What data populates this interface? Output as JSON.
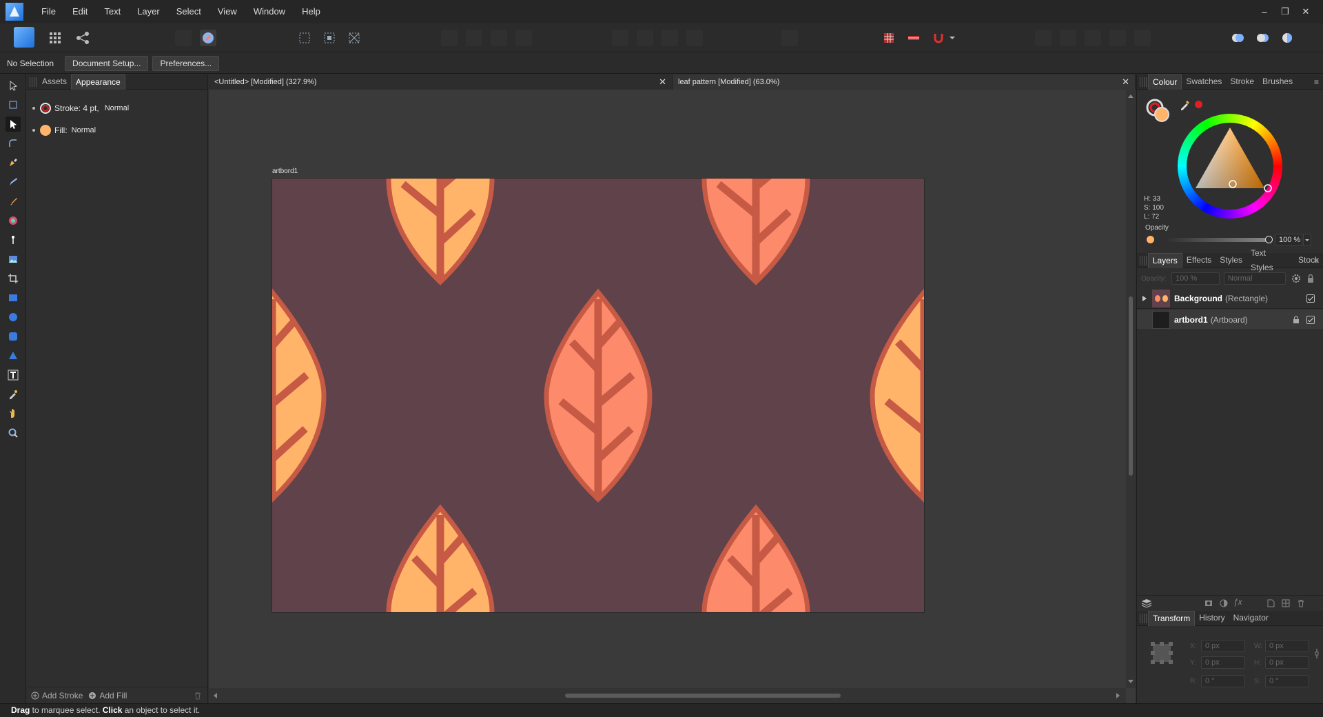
{
  "menu": {
    "items": [
      "File",
      "Edit",
      "Text",
      "Layer",
      "Select",
      "View",
      "Window",
      "Help"
    ]
  },
  "window_controls": {
    "minimize": "–",
    "restore": "❐",
    "close": "✕"
  },
  "context": {
    "selection": "No Selection",
    "doc_setup": "Document Setup...",
    "preferences": "Preferences..."
  },
  "left_panel": {
    "tabs": [
      "Assets",
      "Appearance"
    ],
    "stroke_label": "Stroke: 4 pt,",
    "stroke_mode": "Normal",
    "fill_label": "Fill:",
    "fill_mode": "Normal",
    "add_stroke": "Add Stroke",
    "add_fill": "Add Fill"
  },
  "documents": {
    "tab1": "<Untitled> [Modified] (327.9%)",
    "tab2": "leaf pattern [Modified] (63.0%)",
    "artboard_label": "artbord1"
  },
  "colour_panel": {
    "tabs": [
      "Colour",
      "Swatches",
      "Stroke",
      "Brushes"
    ],
    "h": "H: 33",
    "s": "S: 100",
    "l": "L: 72",
    "opacity_label": "Opacity",
    "opacity_value": "100 %",
    "fill_color": "#ffb46a",
    "accent_red": "#e02020"
  },
  "layers_panel": {
    "tabs": [
      "Layers",
      "Effects",
      "Styles",
      "Text Styles",
      "Stock"
    ],
    "opacity_label": "Opacity:",
    "opacity_value": "100 %",
    "blend_mode": "Normal",
    "rows": [
      {
        "name": "Background",
        "type": "(Rectangle)"
      },
      {
        "name": "artbord1",
        "type": "(Artboard)"
      }
    ]
  },
  "transform_panel": {
    "tabs": [
      "Transform",
      "History",
      "Navigator"
    ],
    "x_label": "X:",
    "x": "0 px",
    "y_label": "Y:",
    "y": "0 px",
    "w_label": "W:",
    "w": "0 px",
    "h_label": "H:",
    "h": "0 px",
    "r_label": "R:",
    "r": "0 °",
    "s_label": "S:",
    "s": "0 °"
  },
  "status": {
    "drag": "Drag",
    "drag_text": " to marquee select. ",
    "click": "Click",
    "click_text": " an object to select it."
  },
  "colors": {
    "artboard_bg": "#5f424a",
    "leaf_orange": "#ffb46a",
    "leaf_salmon": "#fd8a6a",
    "leaf_stroke": "#c65a45"
  }
}
